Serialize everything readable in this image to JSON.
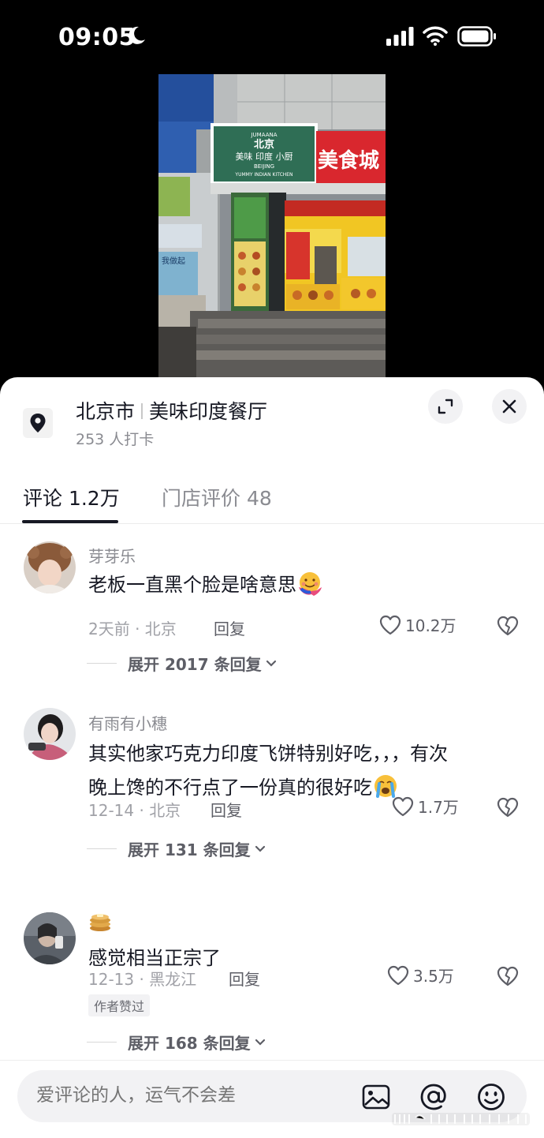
{
  "status_bar": {
    "time": "09:05"
  },
  "location": {
    "city": "北京市",
    "place": "美味印度餐厅",
    "checkins": "253 人打卡"
  },
  "photo_signs": {
    "sign_brand": "JUMAANA",
    "sign_cn_1": "北京",
    "sign_cn_2": "美味 印度 小厨",
    "sign_en_1": "BEIJING",
    "sign_en_2": "YUMMY INDIAN KITCHEN",
    "sign_red": "美食城",
    "wall_text": "我做起"
  },
  "tabs": [
    {
      "label": "评论 1.2万"
    },
    {
      "label": "门店评价 48"
    }
  ],
  "comments": [
    {
      "user": "芽芽乐",
      "text": "老板一直黑个脸是啥意思",
      "meta": "2天前 · 北京",
      "reply": "回复",
      "likes": "10.2万",
      "expand": "展开 2017 条回复"
    },
    {
      "user": "有雨有小穗",
      "text_line1": "其实他家巧克力印度飞饼特别好吃，，，有次",
      "text_line2": "晚上馋的不行点了一份真的很好吃",
      "meta": "12-14 · 北京",
      "reply": "回复",
      "likes": "1.7万",
      "expand": "展开 131 条回复"
    },
    {
      "user": "",
      "text": "感觉相当正宗了",
      "meta": "12-13 · 黑龙江",
      "reply": "回复",
      "likes": "3.5万",
      "badge": "作者赞过",
      "expand": "展开 168 条回复"
    }
  ],
  "input": {
    "placeholder": "爱评论的人，运气不会差"
  },
  "colors": {
    "text_primary": "#161823",
    "text_secondary": "#8a8b91",
    "sheet_bg": "#ffffff",
    "page_bg": "#000000"
  }
}
